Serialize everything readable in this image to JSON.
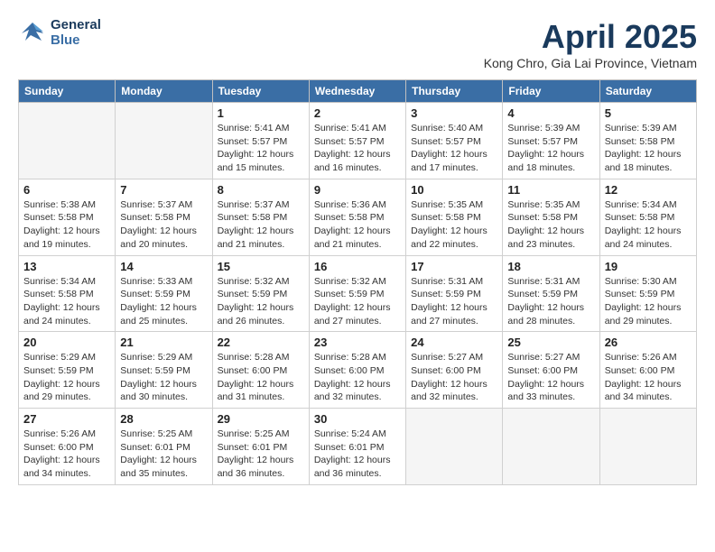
{
  "header": {
    "logo_line1": "General",
    "logo_line2": "Blue",
    "month_year": "April 2025",
    "location": "Kong Chro, Gia Lai Province, Vietnam"
  },
  "weekdays": [
    "Sunday",
    "Monday",
    "Tuesday",
    "Wednesday",
    "Thursday",
    "Friday",
    "Saturday"
  ],
  "weeks": [
    [
      {
        "day": "",
        "sunrise": "",
        "sunset": "",
        "daylight": "",
        "empty": true
      },
      {
        "day": "",
        "sunrise": "",
        "sunset": "",
        "daylight": "",
        "empty": true
      },
      {
        "day": "1",
        "sunrise": "Sunrise: 5:41 AM",
        "sunset": "Sunset: 5:57 PM",
        "daylight": "Daylight: 12 hours and 15 minutes.",
        "empty": false
      },
      {
        "day": "2",
        "sunrise": "Sunrise: 5:41 AM",
        "sunset": "Sunset: 5:57 PM",
        "daylight": "Daylight: 12 hours and 16 minutes.",
        "empty": false
      },
      {
        "day": "3",
        "sunrise": "Sunrise: 5:40 AM",
        "sunset": "Sunset: 5:57 PM",
        "daylight": "Daylight: 12 hours and 17 minutes.",
        "empty": false
      },
      {
        "day": "4",
        "sunrise": "Sunrise: 5:39 AM",
        "sunset": "Sunset: 5:57 PM",
        "daylight": "Daylight: 12 hours and 18 minutes.",
        "empty": false
      },
      {
        "day": "5",
        "sunrise": "Sunrise: 5:39 AM",
        "sunset": "Sunset: 5:58 PM",
        "daylight": "Daylight: 12 hours and 18 minutes.",
        "empty": false
      }
    ],
    [
      {
        "day": "6",
        "sunrise": "Sunrise: 5:38 AM",
        "sunset": "Sunset: 5:58 PM",
        "daylight": "Daylight: 12 hours and 19 minutes.",
        "empty": false
      },
      {
        "day": "7",
        "sunrise": "Sunrise: 5:37 AM",
        "sunset": "Sunset: 5:58 PM",
        "daylight": "Daylight: 12 hours and 20 minutes.",
        "empty": false
      },
      {
        "day": "8",
        "sunrise": "Sunrise: 5:37 AM",
        "sunset": "Sunset: 5:58 PM",
        "daylight": "Daylight: 12 hours and 21 minutes.",
        "empty": false
      },
      {
        "day": "9",
        "sunrise": "Sunrise: 5:36 AM",
        "sunset": "Sunset: 5:58 PM",
        "daylight": "Daylight: 12 hours and 21 minutes.",
        "empty": false
      },
      {
        "day": "10",
        "sunrise": "Sunrise: 5:35 AM",
        "sunset": "Sunset: 5:58 PM",
        "daylight": "Daylight: 12 hours and 22 minutes.",
        "empty": false
      },
      {
        "day": "11",
        "sunrise": "Sunrise: 5:35 AM",
        "sunset": "Sunset: 5:58 PM",
        "daylight": "Daylight: 12 hours and 23 minutes.",
        "empty": false
      },
      {
        "day": "12",
        "sunrise": "Sunrise: 5:34 AM",
        "sunset": "Sunset: 5:58 PM",
        "daylight": "Daylight: 12 hours and 24 minutes.",
        "empty": false
      }
    ],
    [
      {
        "day": "13",
        "sunrise": "Sunrise: 5:34 AM",
        "sunset": "Sunset: 5:58 PM",
        "daylight": "Daylight: 12 hours and 24 minutes.",
        "empty": false
      },
      {
        "day": "14",
        "sunrise": "Sunrise: 5:33 AM",
        "sunset": "Sunset: 5:59 PM",
        "daylight": "Daylight: 12 hours and 25 minutes.",
        "empty": false
      },
      {
        "day": "15",
        "sunrise": "Sunrise: 5:32 AM",
        "sunset": "Sunset: 5:59 PM",
        "daylight": "Daylight: 12 hours and 26 minutes.",
        "empty": false
      },
      {
        "day": "16",
        "sunrise": "Sunrise: 5:32 AM",
        "sunset": "Sunset: 5:59 PM",
        "daylight": "Daylight: 12 hours and 27 minutes.",
        "empty": false
      },
      {
        "day": "17",
        "sunrise": "Sunrise: 5:31 AM",
        "sunset": "Sunset: 5:59 PM",
        "daylight": "Daylight: 12 hours and 27 minutes.",
        "empty": false
      },
      {
        "day": "18",
        "sunrise": "Sunrise: 5:31 AM",
        "sunset": "Sunset: 5:59 PM",
        "daylight": "Daylight: 12 hours and 28 minutes.",
        "empty": false
      },
      {
        "day": "19",
        "sunrise": "Sunrise: 5:30 AM",
        "sunset": "Sunset: 5:59 PM",
        "daylight": "Daylight: 12 hours and 29 minutes.",
        "empty": false
      }
    ],
    [
      {
        "day": "20",
        "sunrise": "Sunrise: 5:29 AM",
        "sunset": "Sunset: 5:59 PM",
        "daylight": "Daylight: 12 hours and 29 minutes.",
        "empty": false
      },
      {
        "day": "21",
        "sunrise": "Sunrise: 5:29 AM",
        "sunset": "Sunset: 5:59 PM",
        "daylight": "Daylight: 12 hours and 30 minutes.",
        "empty": false
      },
      {
        "day": "22",
        "sunrise": "Sunrise: 5:28 AM",
        "sunset": "Sunset: 6:00 PM",
        "daylight": "Daylight: 12 hours and 31 minutes.",
        "empty": false
      },
      {
        "day": "23",
        "sunrise": "Sunrise: 5:28 AM",
        "sunset": "Sunset: 6:00 PM",
        "daylight": "Daylight: 12 hours and 32 minutes.",
        "empty": false
      },
      {
        "day": "24",
        "sunrise": "Sunrise: 5:27 AM",
        "sunset": "Sunset: 6:00 PM",
        "daylight": "Daylight: 12 hours and 32 minutes.",
        "empty": false
      },
      {
        "day": "25",
        "sunrise": "Sunrise: 5:27 AM",
        "sunset": "Sunset: 6:00 PM",
        "daylight": "Daylight: 12 hours and 33 minutes.",
        "empty": false
      },
      {
        "day": "26",
        "sunrise": "Sunrise: 5:26 AM",
        "sunset": "Sunset: 6:00 PM",
        "daylight": "Daylight: 12 hours and 34 minutes.",
        "empty": false
      }
    ],
    [
      {
        "day": "27",
        "sunrise": "Sunrise: 5:26 AM",
        "sunset": "Sunset: 6:00 PM",
        "daylight": "Daylight: 12 hours and 34 minutes.",
        "empty": false
      },
      {
        "day": "28",
        "sunrise": "Sunrise: 5:25 AM",
        "sunset": "Sunset: 6:01 PM",
        "daylight": "Daylight: 12 hours and 35 minutes.",
        "empty": false
      },
      {
        "day": "29",
        "sunrise": "Sunrise: 5:25 AM",
        "sunset": "Sunset: 6:01 PM",
        "daylight": "Daylight: 12 hours and 36 minutes.",
        "empty": false
      },
      {
        "day": "30",
        "sunrise": "Sunrise: 5:24 AM",
        "sunset": "Sunset: 6:01 PM",
        "daylight": "Daylight: 12 hours and 36 minutes.",
        "empty": false
      },
      {
        "day": "",
        "sunrise": "",
        "sunset": "",
        "daylight": "",
        "empty": true
      },
      {
        "day": "",
        "sunrise": "",
        "sunset": "",
        "daylight": "",
        "empty": true
      },
      {
        "day": "",
        "sunrise": "",
        "sunset": "",
        "daylight": "",
        "empty": true
      }
    ]
  ]
}
